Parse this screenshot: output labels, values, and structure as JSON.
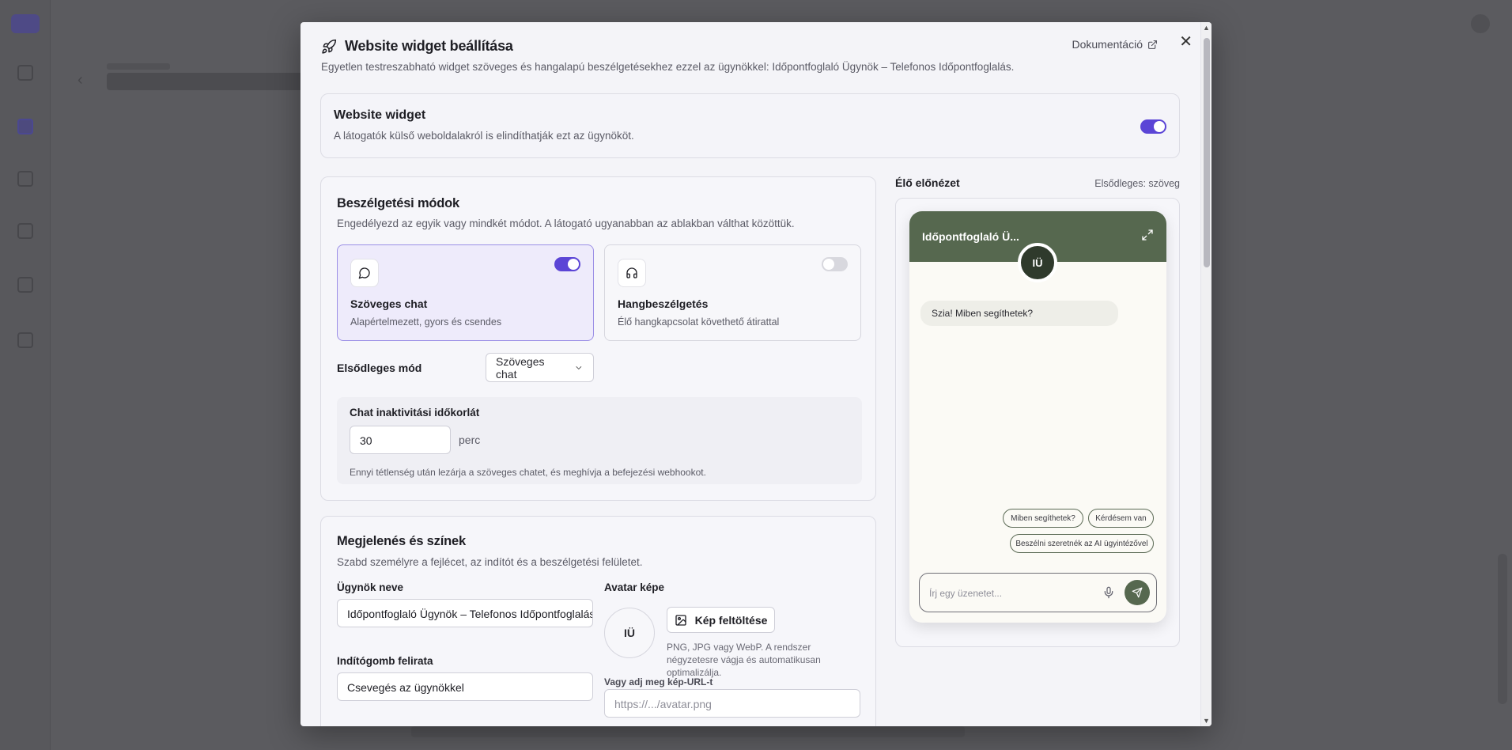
{
  "modal": {
    "title": "Website widget beállítása",
    "subtitle": "Egyetlen testreszabható widget szöveges és hangalapú beszélgetésekhez ezzel az ügynökkel: Időpontfoglaló Ügynök – Telefonos Időpontfoglalás.",
    "doc_link": "Dokumentáció",
    "close_icon": "close-icon"
  },
  "widget": {
    "title": "Website widget",
    "description": "A látogatók külső weboldalakról is elindíthatják ezt az ügynököt.",
    "enabled": true
  },
  "modes": {
    "title": "Beszélgetési módok",
    "subtitle": "Engedélyezd az egyik vagy mindkét módot. A látogató ugyanabban az ablakban válthat közöttük.",
    "text_chat": {
      "name": "Szöveges chat",
      "desc": "Alapértelmezett, gyors és csendes",
      "enabled": true,
      "icon": "chat-bubble-icon"
    },
    "voice": {
      "name": "Hangbeszélgetés",
      "desc": "Élő hangkapcsolat követhető átirattal",
      "enabled": false,
      "icon": "headphones-icon"
    },
    "primary_label": "Elsődleges mód",
    "primary_value": "Szöveges chat",
    "inactivity": {
      "label": "Chat inaktivitási időkorlát",
      "value": "30",
      "unit": "perc",
      "hint": "Ennyi tétlenség után lezárja a szöveges chatet, és meghívja a befejezési webhookot."
    }
  },
  "looks": {
    "title": "Megjelenés és színek",
    "subtitle": "Szabd személyre a fejlécet, az indítót és a beszélgetési felületet.",
    "agent_name_label": "Ügynök neve",
    "agent_name_value": "Időpontfoglaló Ügynök – Telefonos Időpontfoglalás",
    "avatar_label": "Avatar képe",
    "avatar_initials": "IÜ",
    "upload_button": "Kép feltöltése",
    "upload_note": "PNG, JPG vagy WebP. A rendszer négyzetesre vágja és automatikusan optimalizálja.",
    "launcher_label": "Indítógomb felirata",
    "launcher_value": "Csevegés az ügynökkel",
    "url_label": "Vagy adj meg kép-URL-t",
    "url_placeholder": "https://.../avatar.png"
  },
  "preview": {
    "label": "Élő előnézet",
    "primary": "Elsődleges: szöveg",
    "header_name": "Időpontfoglaló Ü...",
    "avatar": "IÜ",
    "greeting": "Szia! Miben segíthetek?",
    "chips": [
      "Miben segíthetek?",
      "Kérdésem van",
      "Beszélni szeretnék az AI ügyintézővel"
    ],
    "input_placeholder": "Írj egy üzenetet...",
    "header_color": "#56684f"
  },
  "colors": {
    "accent": "#5b45d6",
    "preview_header": "#56684f"
  }
}
